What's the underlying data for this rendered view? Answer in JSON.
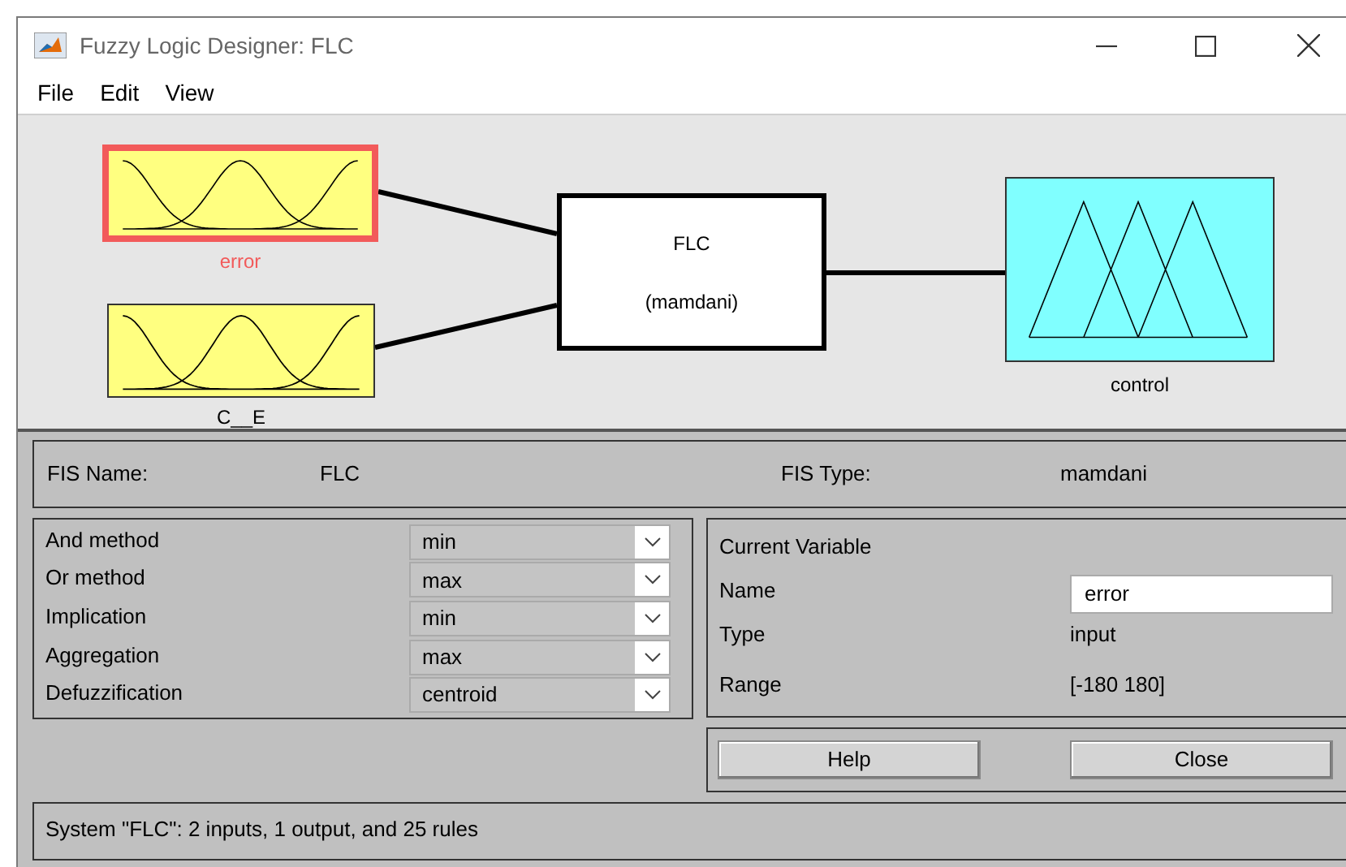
{
  "window": {
    "title": "Fuzzy Logic Designer: FLC"
  },
  "menu": [
    "File",
    "Edit",
    "View"
  ],
  "diagram": {
    "inputs": [
      {
        "name": "error",
        "selected": true
      },
      {
        "name": "C__E",
        "selected": false
      }
    ],
    "system": {
      "name": "FLC",
      "type": "(mamdani)"
    },
    "outputs": [
      {
        "name": "control",
        "selected": false
      }
    ]
  },
  "fis": {
    "name_label": "FIS Name:",
    "name": "FLC",
    "type_label": "FIS Type:",
    "type": "mamdani"
  },
  "methods": [
    {
      "label": "And method",
      "value": "min"
    },
    {
      "label": "Or method",
      "value": "max"
    },
    {
      "label": "Implication",
      "value": "min"
    },
    {
      "label": "Aggregation",
      "value": "max"
    },
    {
      "label": "Defuzzification",
      "value": "centroid"
    }
  ],
  "current_variable": {
    "title": "Current Variable",
    "name_label": "Name",
    "name": "error",
    "type_label": "Type",
    "type": "input",
    "range_label": "Range",
    "range": "[-180 180]"
  },
  "buttons": [
    "Help",
    "Close"
  ],
  "status": "System \"FLC\": 2 inputs, 1 output, and 25 rules"
}
